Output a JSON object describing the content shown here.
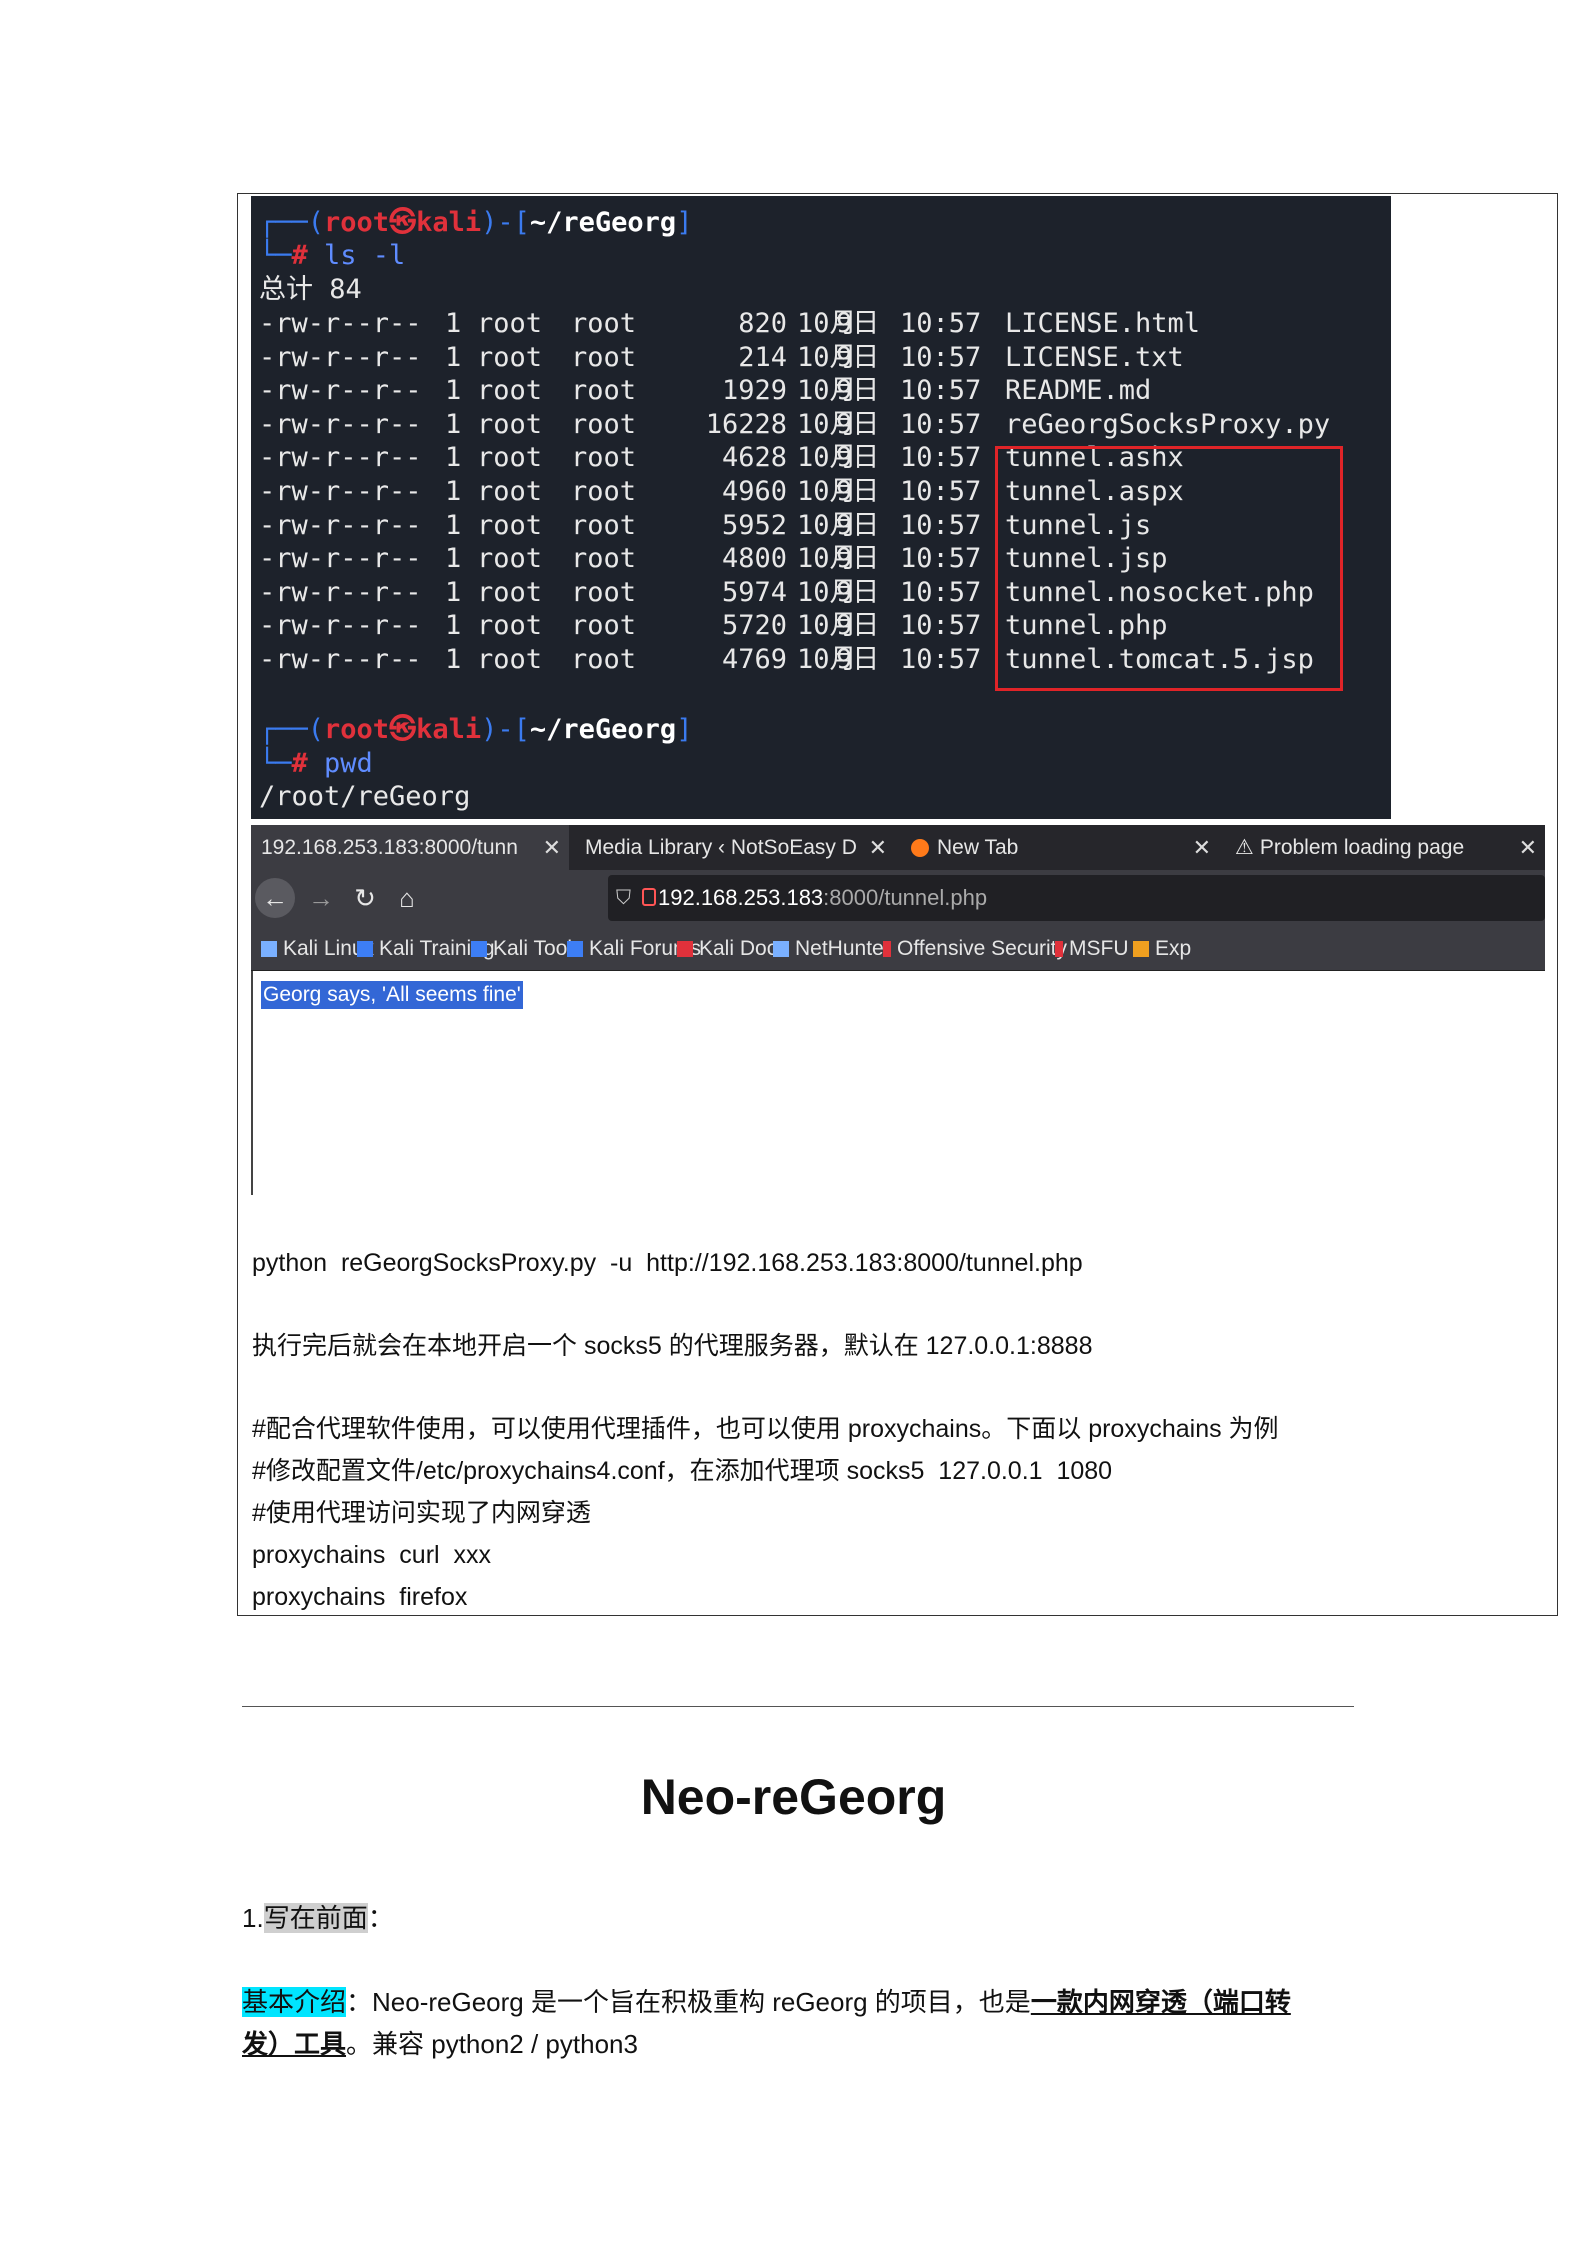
{
  "terminal": {
    "prompt1": {
      "open": "┌──(",
      "user": "root",
      "sep": "㉿",
      "host": "kali",
      "close": ")-[",
      "path": "~/reGeorg",
      "end": "]"
    },
    "cmd1": {
      "prefix": "└─",
      "hash": "#",
      "command": " ls -l"
    },
    "total": "总计 84",
    "files": [
      {
        "perm": "-rw-r--r--",
        "links": "1",
        "owner": "root",
        "group": "root",
        "size": "820",
        "month": "10月",
        "day": "9日",
        "time": "10:57",
        "name": "LICENSE.html"
      },
      {
        "perm": "-rw-r--r--",
        "links": "1",
        "owner": "root",
        "group": "root",
        "size": "214",
        "month": "10月",
        "day": "9日",
        "time": "10:57",
        "name": "LICENSE.txt"
      },
      {
        "perm": "-rw-r--r--",
        "links": "1",
        "owner": "root",
        "group": "root",
        "size": "1929",
        "month": "10月",
        "day": "9日",
        "time": "10:57",
        "name": "README.md"
      },
      {
        "perm": "-rw-r--r--",
        "links": "1",
        "owner": "root",
        "group": "root",
        "size": "16228",
        "month": "10月",
        "day": "9日",
        "time": "10:57",
        "name": "reGeorgSocksProxy.py"
      },
      {
        "perm": "-rw-r--r--",
        "links": "1",
        "owner": "root",
        "group": "root",
        "size": "4628",
        "month": "10月",
        "day": "9日",
        "time": "10:57",
        "name": "tunnel.ashx"
      },
      {
        "perm": "-rw-r--r--",
        "links": "1",
        "owner": "root",
        "group": "root",
        "size": "4960",
        "month": "10月",
        "day": "9日",
        "time": "10:57",
        "name": "tunnel.aspx"
      },
      {
        "perm": "-rw-r--r--",
        "links": "1",
        "owner": "root",
        "group": "root",
        "size": "5952",
        "month": "10月",
        "day": "9日",
        "time": "10:57",
        "name": "tunnel.js"
      },
      {
        "perm": "-rw-r--r--",
        "links": "1",
        "owner": "root",
        "group": "root",
        "size": "4800",
        "month": "10月",
        "day": "9日",
        "time": "10:57",
        "name": "tunnel.jsp"
      },
      {
        "perm": "-rw-r--r--",
        "links": "1",
        "owner": "root",
        "group": "root",
        "size": "5974",
        "month": "10月",
        "day": "9日",
        "time": "10:57",
        "name": "tunnel.nosocket.php"
      },
      {
        "perm": "-rw-r--r--",
        "links": "1",
        "owner": "root",
        "group": "root",
        "size": "5720",
        "month": "10月",
        "day": "9日",
        "time": "10:57",
        "name": "tunnel.php"
      },
      {
        "perm": "-rw-r--r--",
        "links": "1",
        "owner": "root",
        "group": "root",
        "size": "4769",
        "month": "10月",
        "day": "9日",
        "time": "10:57",
        "name": "tunnel.tomcat.5.jsp"
      }
    ],
    "prompt2": {
      "open": "┌──(",
      "user": "root",
      "sep": "㉿",
      "host": "kali",
      "close": ")-[",
      "path": "~/reGeorg",
      "end": "]"
    },
    "cmd2": {
      "prefix": "└─",
      "hash": "#",
      "command": " pwd"
    },
    "output": "/root/reGeorg"
  },
  "browser": {
    "tabs": [
      {
        "label": "192.168.253.183:8000/tunn"
      },
      {
        "label": "Media Library ‹ NotSoEasy D"
      },
      {
        "label": "New Tab"
      },
      {
        "label": "Problem loading page"
      }
    ],
    "url_host": "192.168.253.183",
    "url_rest": ":8000/tunnel.php",
    "bookmarks": [
      "Kali Linux",
      "Kali Training",
      "Kali Tools",
      "Kali Forums",
      "Kali Docs",
      "NetHunter",
      "Offensive Security",
      "MSFU",
      "Exp"
    ],
    "page_text": "Georg says, 'All seems fine'"
  },
  "doc": {
    "line_cmd": "python  reGeorgSocksProxy.py  -u  http://192.168.253.183:8000/tunnel.php",
    "line_exec": "执行完后就会在本地开启一个 socks5 的代理服务器，默认在 127.0.0.1:8888",
    "line_proxy1": "#配合代理软件使用，可以使用代理插件，也可以使用 proxychains。下面以 proxychains 为例",
    "line_proxy2": "#修改配置文件/etc/proxychains4.conf，在添加代理项 socks5  127.0.0.1  1080",
    "line_proxy3": "#使用代理访问实现了内网穿透",
    "line_proxy4": "proxychains  curl  xxx",
    "line_proxy5": "proxychains  firefox",
    "heading": "Neo-reGeorg",
    "section_num": "1.",
    "section_title": "写在前面",
    "section_colon": "：",
    "intro_label": "基本介绍",
    "intro_text1": "：Neo-reGeorg 是一个旨在积极重构 reGeorg 的项目，也是",
    "intro_link1": "一款内网穿透（端口转",
    "intro_link2": "发）工具",
    "intro_text2": "。兼容 python2 / python3"
  }
}
